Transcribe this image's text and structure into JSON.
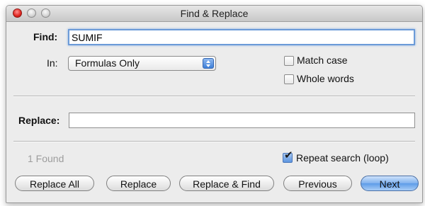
{
  "window": {
    "title": "Find & Replace"
  },
  "find": {
    "label": "Find:",
    "value": "SUMIF"
  },
  "in": {
    "label": "In:",
    "selected": "Formulas Only"
  },
  "options": {
    "match_case": {
      "label": "Match case",
      "checked": false
    },
    "whole_words": {
      "label": "Whole words",
      "checked": false
    },
    "repeat_search": {
      "label": "Repeat search (loop)",
      "checked": true
    }
  },
  "replace": {
    "label": "Replace:",
    "value": ""
  },
  "status": {
    "found": "1 Found"
  },
  "buttons": {
    "replace_all": "Replace All",
    "replace": "Replace",
    "replace_and_find": "Replace & Find",
    "previous": "Previous",
    "next": "Next"
  },
  "colors": {
    "accent": "#5d9be8",
    "focus_ring": "#6c9bd8",
    "close": "#e0241e"
  },
  "icons": {
    "close": "close-window-icon",
    "minimize": "minimize-window-icon",
    "zoom": "zoom-window-icon",
    "select": "select-stepper-icon",
    "check": "checkmark-icon"
  }
}
